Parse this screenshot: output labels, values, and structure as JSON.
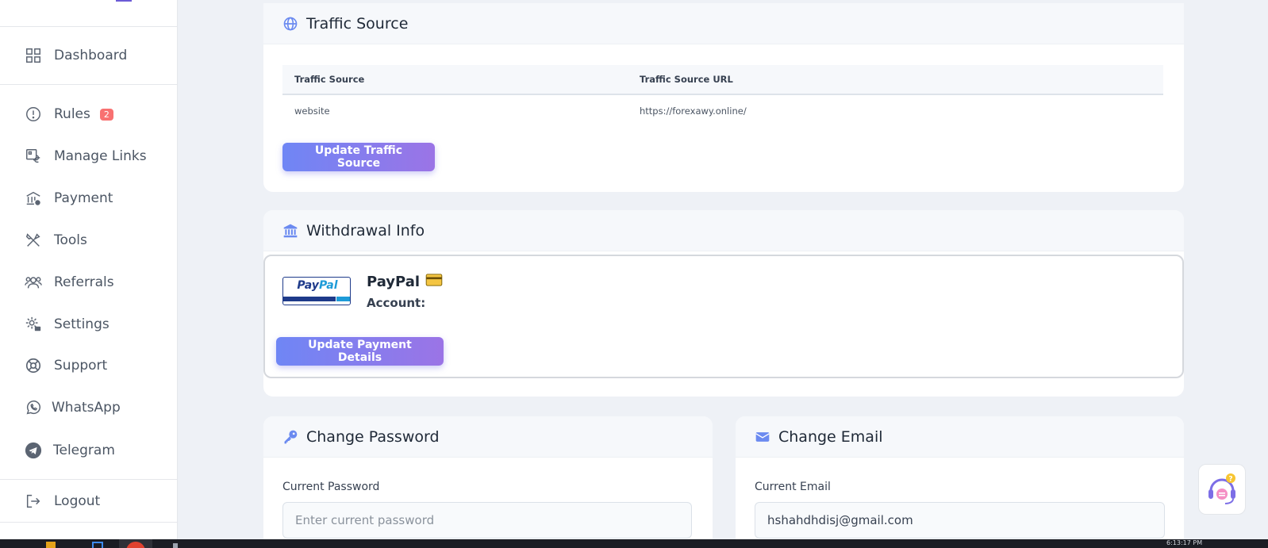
{
  "sidebar": {
    "items": [
      {
        "label": "Dashboard",
        "icon": "grid-icon"
      },
      {
        "label": "Rules",
        "icon": "alert-circle-icon",
        "badge": "2"
      },
      {
        "label": "Manage Links",
        "icon": "link-icon"
      },
      {
        "label": "Payment",
        "icon": "bank-icon"
      },
      {
        "label": "Tools",
        "icon": "tools-icon"
      },
      {
        "label": "Referrals",
        "icon": "users-icon"
      },
      {
        "label": "Settings",
        "icon": "gear-icon"
      },
      {
        "label": "Support",
        "icon": "lifebuoy-icon"
      },
      {
        "label": "WhatsApp",
        "icon": "whatsapp-icon"
      },
      {
        "label": "Telegram",
        "icon": "telegram-icon"
      },
      {
        "label": "Logout",
        "icon": "logout-icon"
      }
    ]
  },
  "traffic_source": {
    "title": "Traffic Source",
    "columns": [
      "Traffic Source",
      "Traffic Source URL"
    ],
    "rows": [
      [
        "website",
        "https://forexawy.online/"
      ]
    ],
    "button_label": "Update Traffic Source"
  },
  "withdrawal": {
    "title": "Withdrawal Info",
    "method_name": "PayPal",
    "account_label": "Account:",
    "logo_text_1": "Pay",
    "logo_text_2": "Pal",
    "button_label": "Update Payment Details"
  },
  "change_password": {
    "title": "Change Password",
    "current_label": "Current Password",
    "current_placeholder": "Enter current password"
  },
  "change_email": {
    "title": "Change Email",
    "current_label": "Current Email",
    "current_value": "hshahdhdisj@gmail.com"
  },
  "taskbar": {
    "clock": "6:13:17 PM"
  },
  "colors": {
    "accent_start": "#6f86f5",
    "accent_end": "#9b74e6",
    "icon_blue": "#6b8af0",
    "badge_red": "#f87171"
  }
}
